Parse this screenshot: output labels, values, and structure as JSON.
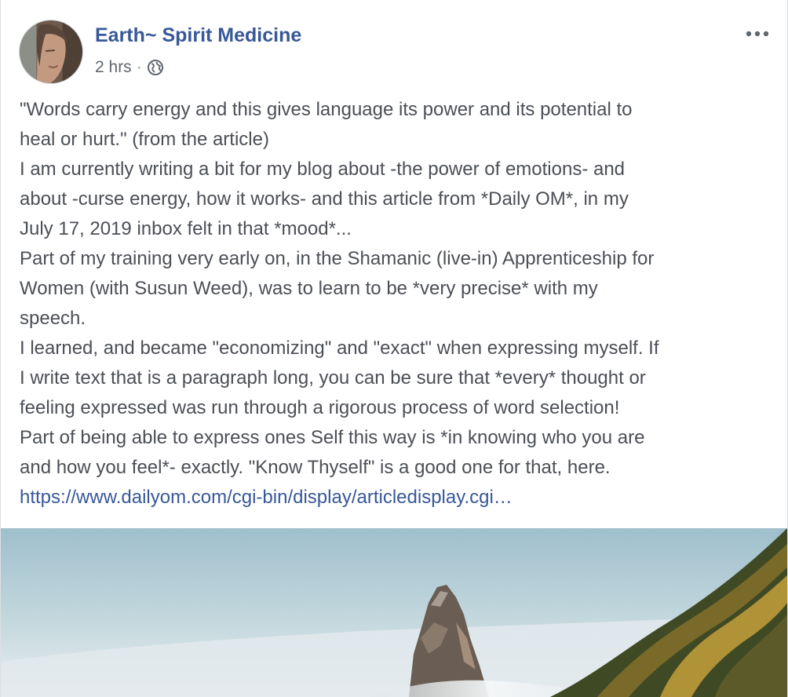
{
  "post": {
    "author": "Earth~ Spirit Medicine",
    "timestamp": "2 hrs",
    "separator": "·",
    "audience_icon": "globe-icon",
    "more_icon": "ellipsis-icon",
    "body_lines": [
      "\"Words carry energy and this gives language its power and its potential to",
      "heal or hurt.\" (from the article)",
      "I am currently writing a bit for my blog about -the power of emotions- and",
      "about -curse energy, how it works- and this article from *Daily OM*, in my",
      "July 17, 2019 inbox felt in that *mood*...",
      "Part of my training very early on, in the Shamanic (live-in) Apprenticeship for",
      "Women (with Susun Weed), was to learn to be *very precise* with my",
      "speech.",
      "I learned, and became \"economizing\" and \"exact\" when expressing myself. If",
      "I write text that is a paragraph long, you can be sure that *every* thought or",
      "feeling expressed was run through a rigorous process of word selection!",
      "Part of being able to express ones Self this way is *in knowing who you are",
      "and how you feel*- exactly. \"Know Thyself\" is a good one for that, here."
    ],
    "link": "https://www.dailyom.com/cgi-bin/display/articledisplay.cgi…"
  },
  "colors": {
    "author_link": "#385898",
    "body_text": "#4b4f56",
    "meta_text": "#616770"
  }
}
